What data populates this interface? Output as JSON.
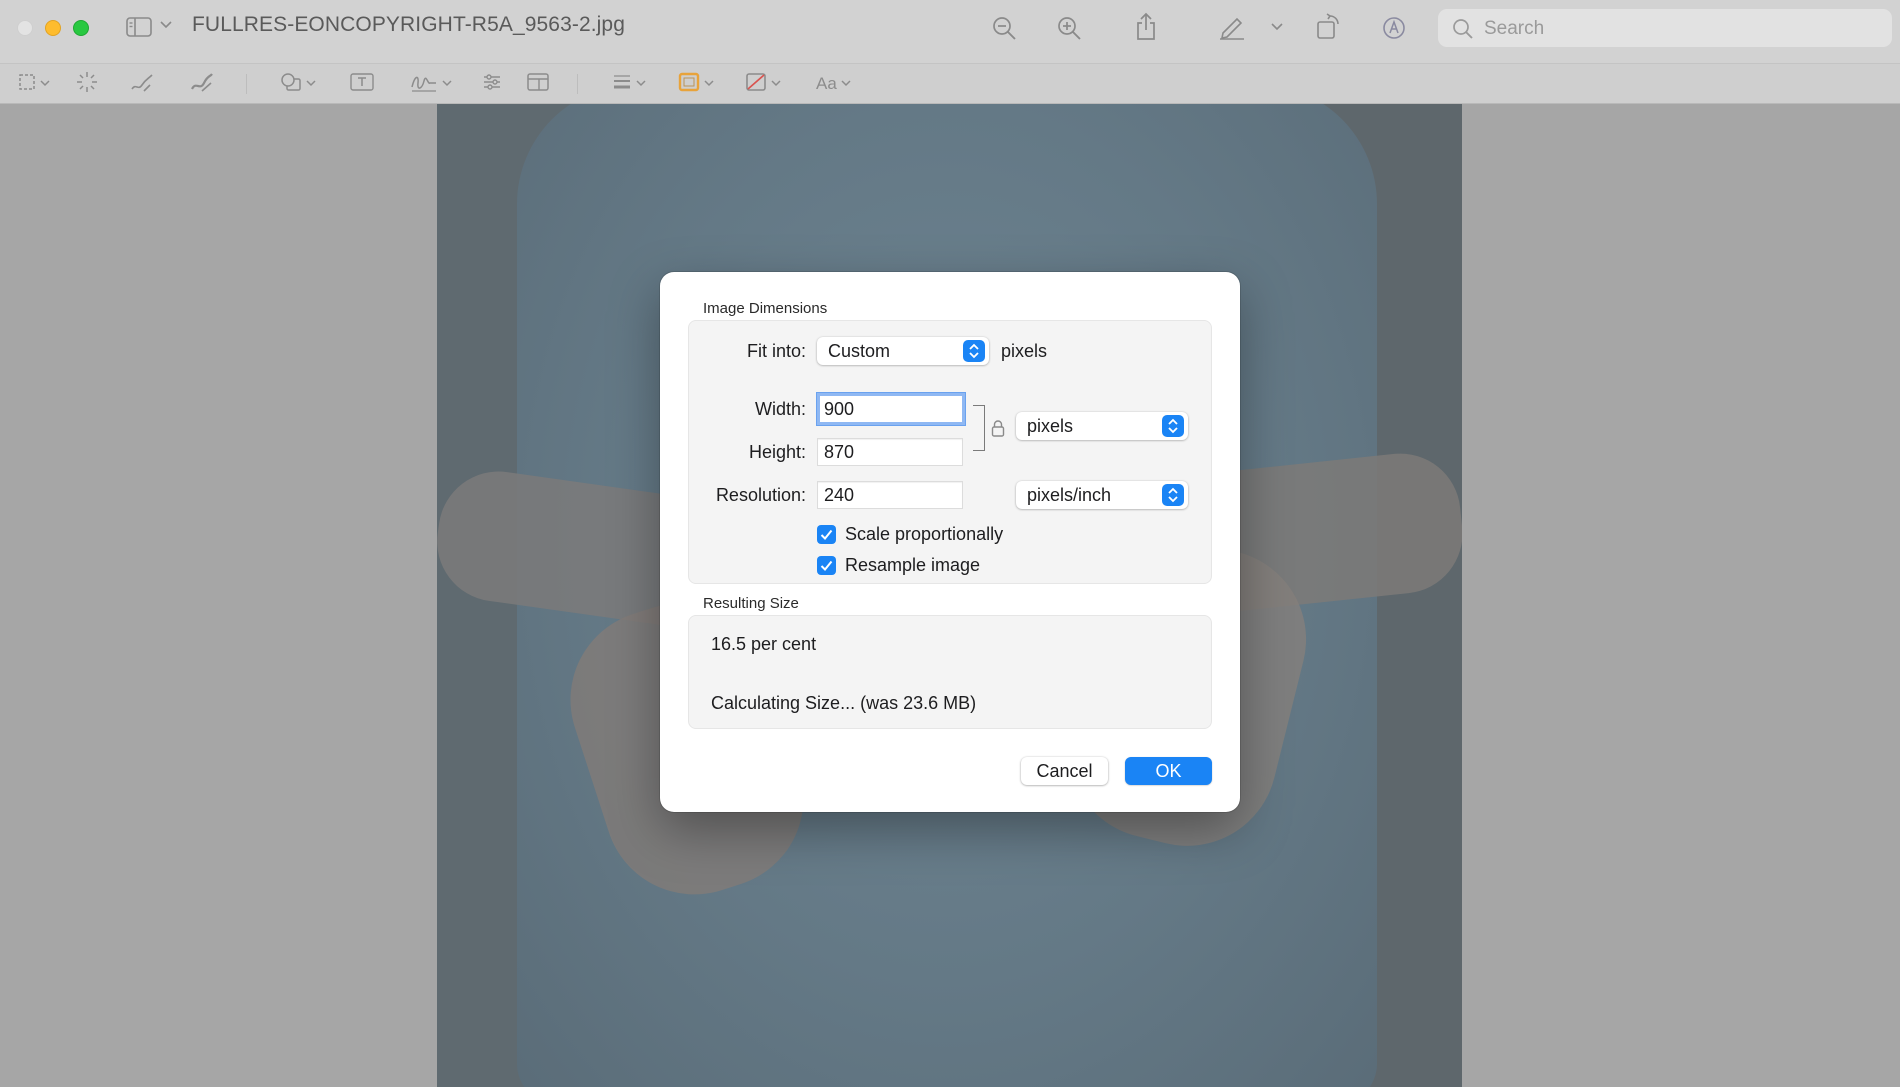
{
  "window": {
    "title": "FULLRES-EONCOPYRIGHT-R5A_9563-2.jpg"
  },
  "titlebar": {
    "search_placeholder": "Search",
    "icons": [
      "sidebar-icon",
      "zoom-out-icon",
      "zoom-in-icon",
      "share-icon",
      "markup-pen-icon",
      "rotate-icon",
      "annotate-icon",
      "search-icon"
    ]
  },
  "toolbar": {
    "text_style_label": "Aa",
    "tools": [
      "rectangular-selection",
      "instant-alpha",
      "sketch",
      "draw",
      "shapes",
      "text",
      "sign",
      "adjust-color",
      "adjust-size",
      "shape-style",
      "border-color",
      "fill-color",
      "text-style"
    ],
    "border_color": "#e8a33b"
  },
  "dialog": {
    "image_dimensions_title": "Image Dimensions",
    "fit_into_label": "Fit into:",
    "fit_into_value": "Custom",
    "fit_into_unit": "pixels",
    "width_label": "Width:",
    "width_value": "900",
    "height_label": "Height:",
    "height_value": "870",
    "dimension_unit": "pixels",
    "resolution_label": "Resolution:",
    "resolution_value": "240",
    "resolution_unit": "pixels/inch",
    "scale_proportionally_label": "Scale proportionally",
    "scale_proportionally_checked": true,
    "resample_image_label": "Resample image",
    "resample_image_checked": true,
    "resulting_size_title": "Resulting Size",
    "percent_text": "16.5 per cent",
    "size_text": "Calculating Size... (was 23.6 MB)",
    "cancel_label": "Cancel",
    "ok_label": "OK"
  },
  "colors": {
    "accent": "#1a84f5",
    "focus_ring": "#8fb8f3",
    "traffic_close": "#e3e3e3",
    "traffic_minimize": "#febc2e",
    "traffic_maximize": "#28c840"
  }
}
